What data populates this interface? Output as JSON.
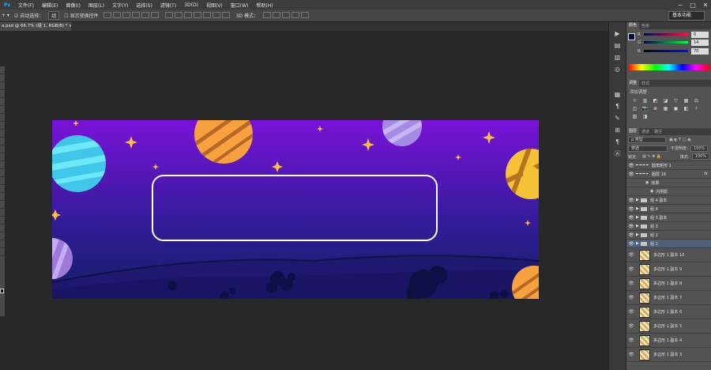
{
  "menu": [
    "文件(F)",
    "编辑(E)",
    "图像(I)",
    "图层(L)",
    "文字(Y)",
    "选择(S)",
    "滤镜(T)",
    "3D(D)",
    "视图(V)",
    "窗口(W)",
    "帮助(H)"
  ],
  "window_controls": [
    "−",
    "□",
    "✕"
  ],
  "options_bar": {
    "move_tool_arrow": "+ ▾",
    "auto_select_label": "自动选择：",
    "auto_select_value": "组",
    "show_transform_label": "显示变换控件",
    "mode_3d_label": "3D 模式："
  },
  "workspace": "基本功能",
  "document_tab": "a.psd @ 66.7% (组 1, RGB/8) * ×",
  "color_panel": {
    "tabs": [
      "颜色",
      "色板"
    ],
    "r_label": "R",
    "r_value": "0",
    "g_label": "G",
    "g_value": "14",
    "b_label": "B",
    "b_value": "70",
    "fg_color": "#000e46"
  },
  "adjust_panel": {
    "tabs": [
      "调整",
      "样式"
    ],
    "title": "添加调整",
    "icons": [
      "☼",
      "▥",
      "◩",
      "◪",
      "▽",
      "▦",
      "⚖",
      "◫",
      "📷",
      "⊕",
      "▦",
      "▣",
      "◧",
      "⚡",
      "▨",
      "◨"
    ]
  },
  "layers_panel": {
    "tabs": [
      "图层",
      "通道",
      "路径"
    ],
    "filter": "ρ 类型",
    "blend_mode": "穿透",
    "opacity_label": "不透明度：",
    "opacity_value": "100%",
    "lock_label": "锁定：",
    "fill_label": "填充：",
    "fill_value": "100%",
    "top_layers": [
      {
        "name": "圆角矩形 1"
      },
      {
        "name": "图层 18",
        "fx": "fx"
      }
    ],
    "effects_label": "效果",
    "inner_shadow_label": "内阴影",
    "groups": [
      "组 4 副本",
      "组 4",
      "组 3 副本",
      "组 3",
      "组 2",
      "组 1"
    ],
    "shape_layers": [
      "多边形 1 副本 10",
      "多边形 1 副本 9",
      "多边形 1 副本 8",
      "多边形 1 副本 7",
      "多边形 1 副本 6",
      "多边形 1 副本 5",
      "多边形 1 副本 4",
      "多边形 1 副本 3"
    ]
  },
  "icon_strip": [
    "▶",
    "▤",
    "▥",
    "◎",
    "▦",
    "¶",
    "✎",
    "⊞",
    "¶",
    "Ⓐ"
  ]
}
